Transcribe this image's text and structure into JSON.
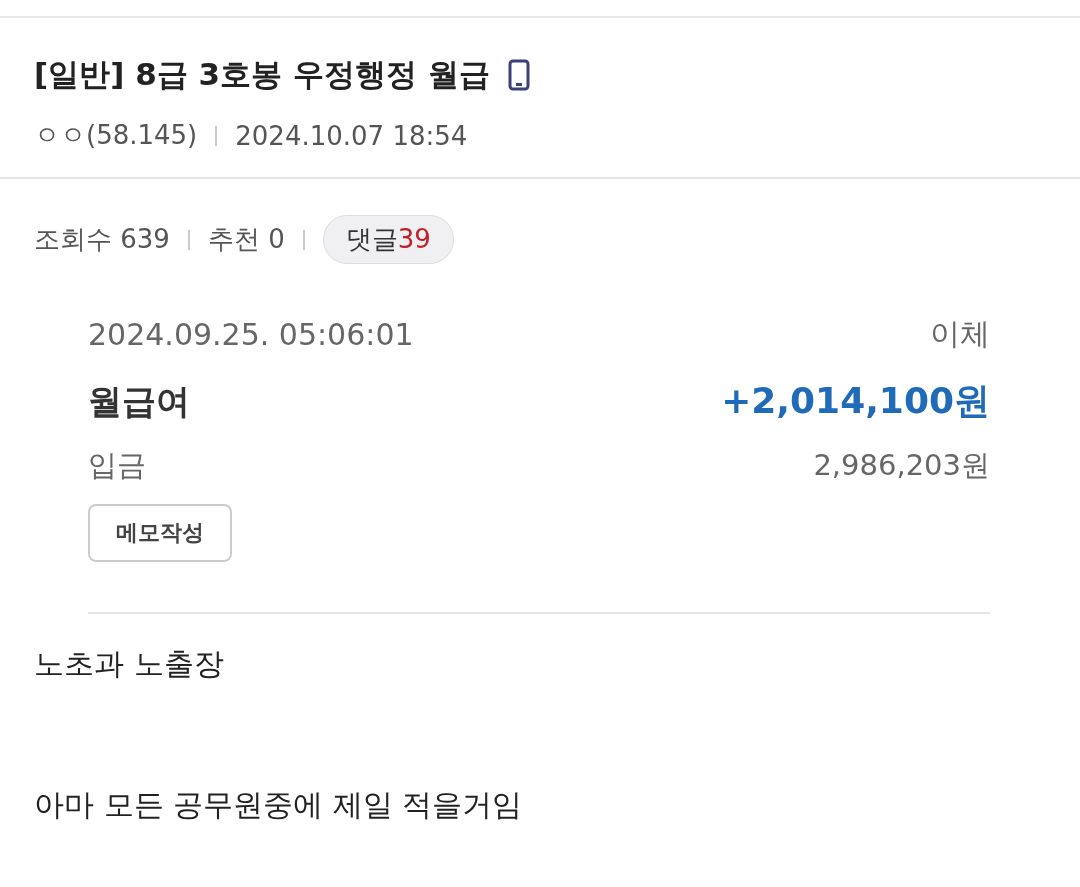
{
  "post": {
    "title": "[일반] 8급 3호봉 우정행정 월급",
    "author": "ㅇㅇ(58.145)",
    "date": "2024.10.07 18:54"
  },
  "stats": {
    "views_label": "조회수",
    "views": "639",
    "recommend_label": "추천",
    "recommend": "0",
    "comments_label": "댓글",
    "comments": "39"
  },
  "transaction": {
    "datetime": "2024.09.25. 05:06:01",
    "type": "이체",
    "name": "월급여",
    "amount": "+2,014,100원",
    "category": "입금",
    "balance": "2,986,203원",
    "memo_button": "메모작성"
  },
  "body": [
    "노초과 노출장",
    "아마 모든 공무원중에 제일 적을거임"
  ]
}
